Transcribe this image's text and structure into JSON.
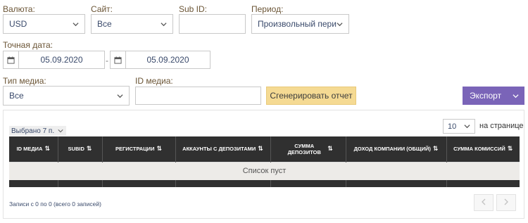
{
  "filters": {
    "currency": {
      "label": "Валюта:",
      "value": "USD"
    },
    "site": {
      "label": "Сайт:",
      "value": "Все"
    },
    "subid": {
      "label": "Sub ID:",
      "value": ""
    },
    "period": {
      "label": "Период:",
      "value": "Произвольный период"
    },
    "exact_date": {
      "label": "Точная дата:",
      "from": "05.09.2020",
      "separator": "-",
      "to": "05.09.2020"
    },
    "media_type": {
      "label": "Тип медиа:",
      "value": "Все"
    },
    "media_id": {
      "label": "ID медиа:",
      "value": ""
    }
  },
  "actions": {
    "generate_label": "Сгенерировать отчет",
    "export_label": "Экспорт"
  },
  "table": {
    "selected_label": "Выбрано 7 п.",
    "per_page_value": "10",
    "per_page_label": "на странице",
    "columns": [
      {
        "label": "ID МЕДИА"
      },
      {
        "label": "SUBID"
      },
      {
        "label": "РЕГИСТРАЦИИ"
      },
      {
        "label": "АККАУНТЫ С ДЕПОЗИТАМИ"
      },
      {
        "label": "СУММА ДЕПОЗИТОВ"
      },
      {
        "label": "ДОХОД КОМПАНИИ (ОБЩИЙ)"
      },
      {
        "label": "СУММА КОМИССИЙ"
      }
    ],
    "empty_text": "Список пуст",
    "records_text": "Записи с 0 по 0 (всего 0 записей)"
  },
  "colors": {
    "accent_purple": "#7a64b8",
    "accent_yellow": "#f5da93",
    "header_dark": "#303030",
    "label_brown": "#6b5536"
  }
}
